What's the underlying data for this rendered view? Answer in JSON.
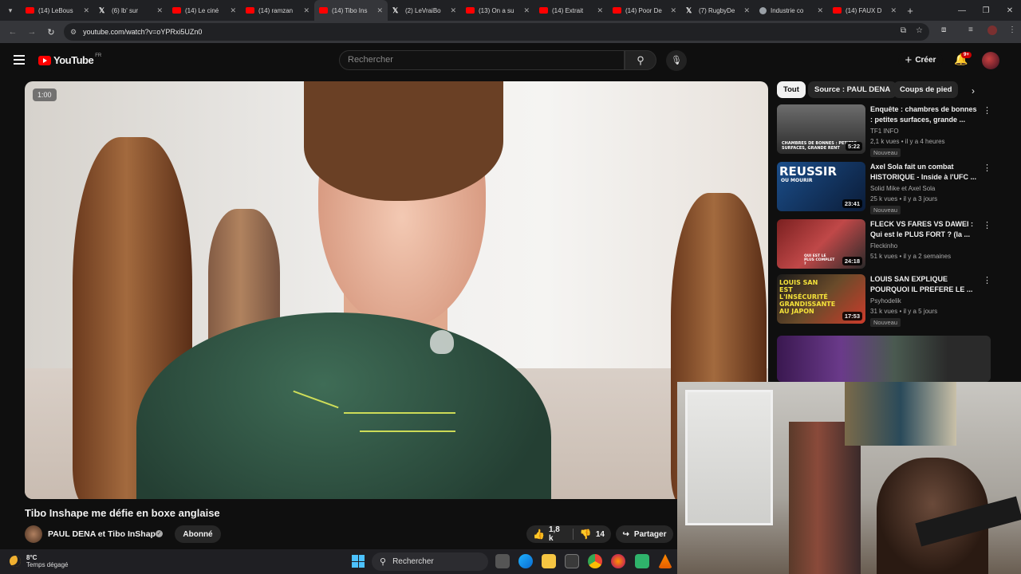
{
  "browser": {
    "tabs": [
      {
        "label": "(14) LeBous",
        "favicon": "yt",
        "active": false
      },
      {
        "label": "(6) lb' sur",
        "favicon": "x",
        "active": false
      },
      {
        "label": "(14) Le ciné",
        "favicon": "yt",
        "active": false
      },
      {
        "label": "(14) ramzan",
        "favicon": "yt",
        "active": false
      },
      {
        "label": "(14) Tibo Ins",
        "favicon": "yt",
        "active": true
      },
      {
        "label": "(2) LeVraiBo",
        "favicon": "x",
        "active": false
      },
      {
        "label": "(13) On a su",
        "favicon": "yt",
        "active": false
      },
      {
        "label": "(14) Extrait",
        "favicon": "yt",
        "active": false
      },
      {
        "label": "(14) Poor De",
        "favicon": "yt",
        "active": false
      },
      {
        "label": "(7) RugbyDe",
        "favicon": "x",
        "active": false
      },
      {
        "label": "Industrie co",
        "favicon": "gen",
        "active": false
      },
      {
        "label": "(14) FAUX D",
        "favicon": "yt",
        "active": false
      }
    ],
    "url": "youtube.com/watch?v=oYPRxi5UZn0"
  },
  "youtube": {
    "logo_text": "YouTube",
    "country_code": "FR",
    "search_placeholder": "Rechercher",
    "create_label": "Créer",
    "notification_count": "9+"
  },
  "video": {
    "timestamp": "1:00",
    "title": "Tibo Inshape me défie en boxe anglaise",
    "channel": "PAUL DENA et Tibo InShape",
    "subscribe_label": "Abonné",
    "likes": "1,8 k",
    "dislikes": "14",
    "share_label": "Partager"
  },
  "chips": [
    "Tout",
    "Source : PAUL DENA",
    "Coups de pied"
  ],
  "recommendations": [
    {
      "title": "Enquête : chambres de bonnes : petites surfaces, grande ...",
      "channel": "TF1 INFO",
      "meta": "2,1 k vues • il y a 4 heures",
      "badge": "Nouveau",
      "duration": "5:22",
      "thumb_text": "CHAMBRES DE BONNES : PETITES SURFACES, GRANDE RENT"
    },
    {
      "title": "Axel Sola fait un combat HISTORIQUE - Inside à l'UFC ...",
      "channel": "Solid Mike et Axel Sola",
      "meta": "25 k vues • il y a 3 jours",
      "badge": "Nouveau",
      "duration": "23:41",
      "thumb_text": "REUSSIR",
      "thumb_subtext": "OU MOURIR"
    },
    {
      "title": "FLECK VS FARES VS DAWEI : Qui est le PLUS FORT ? (la ...",
      "channel": "Fleckinho",
      "meta": "51 k vues • il y a 2 semaines",
      "badge": "",
      "duration": "24:18",
      "thumb_text": "QUI EST LE PLUS COMPLET ?"
    },
    {
      "title": "LOUIS SAN EXPLIQUE POURQUOI IL PREFERE LE ...",
      "channel": "Psyhodelik",
      "meta": "31 k vues • il y a 5 jours",
      "badge": "Nouveau",
      "duration": "17:53",
      "thumb_text": "LOUIS SAN EST L'INSÉCURITÉ GRANDISSANTE AU JAPON"
    }
  ],
  "taskbar": {
    "temperature": "8°C",
    "weather": "Temps dégagé",
    "search_label": "Rechercher"
  },
  "colors": {
    "yt_red": "#ff0000",
    "background": "#0f0f0f",
    "chip_bg": "#272727"
  }
}
